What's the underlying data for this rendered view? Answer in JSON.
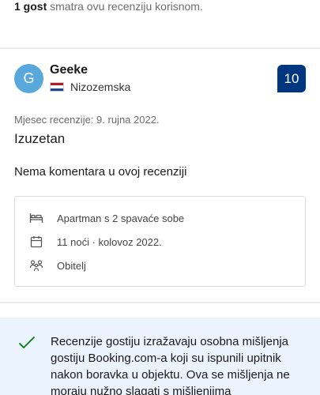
{
  "helpful": {
    "count": "1 gost",
    "text": " smatra ovu recenziju korisnom."
  },
  "review": {
    "avatar_letter": "G",
    "reviewer_name": "Geeke",
    "country": "Nizozemska",
    "flag_icon": "netherlands-flag-icon",
    "score": "10",
    "date": "Mjesec recenzije: 9. rujna 2022.",
    "title": "Izuzetan",
    "comment": "Nema komentara u ovoj recenziji"
  },
  "stay_info": [
    {
      "icon": "bed-icon",
      "text": "Apartman s 2 spavaće sobe"
    },
    {
      "icon": "calendar-icon",
      "text": "11 noći · kolovoz 2022."
    },
    {
      "icon": "family-icon",
      "text": "Obitelj"
    }
  ],
  "notice": {
    "icon": "checkmark-icon",
    "text": "Recenzije gostiju izražavaju osobna mišljenja gostiju Booking.com-a koji su ispunili upitnik nakon boravka u objektu. Ova se mišljenja ne moraju nužno slagati s mišljenjima"
  },
  "colors": {
    "score_bg": "#003580",
    "avatar_bg": "#58a8dc",
    "notice_bg": "#ebf3ff",
    "check": "#008009"
  }
}
